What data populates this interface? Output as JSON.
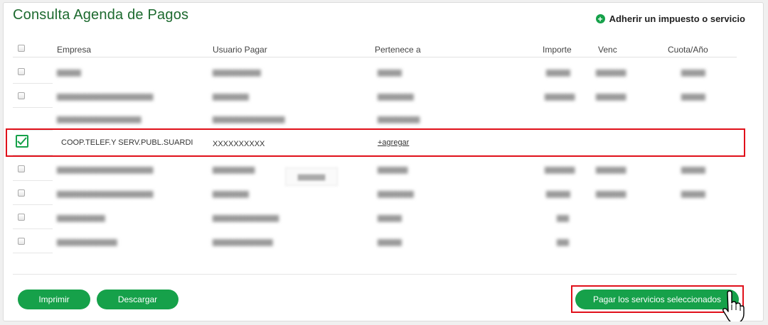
{
  "page": {
    "title": "Consulta Agenda de Pagos",
    "adherir_label": "Adherir un impuesto o servicio"
  },
  "colors": {
    "accent": "#16a14a",
    "title": "#1d6a2f",
    "highlight": "#e0101a"
  },
  "table": {
    "headers": {
      "empresa": "Empresa",
      "usuario": "Usuario Pagar",
      "pertenece": "Pertenece a",
      "importe": "Importe",
      "venc": "Venc",
      "cuota": "Cuota/Año"
    },
    "selected_row": {
      "empresa": "COOP.TELEF.Y SERV.PUBL.SUARDI",
      "usuario": "XXXXXXXXXX",
      "pertenece": "+agregar",
      "checked": true
    }
  },
  "buttons": {
    "imprimir": "Imprimir",
    "descargar": "Descargar",
    "pagar": "Pagar los servicios seleccionados"
  }
}
